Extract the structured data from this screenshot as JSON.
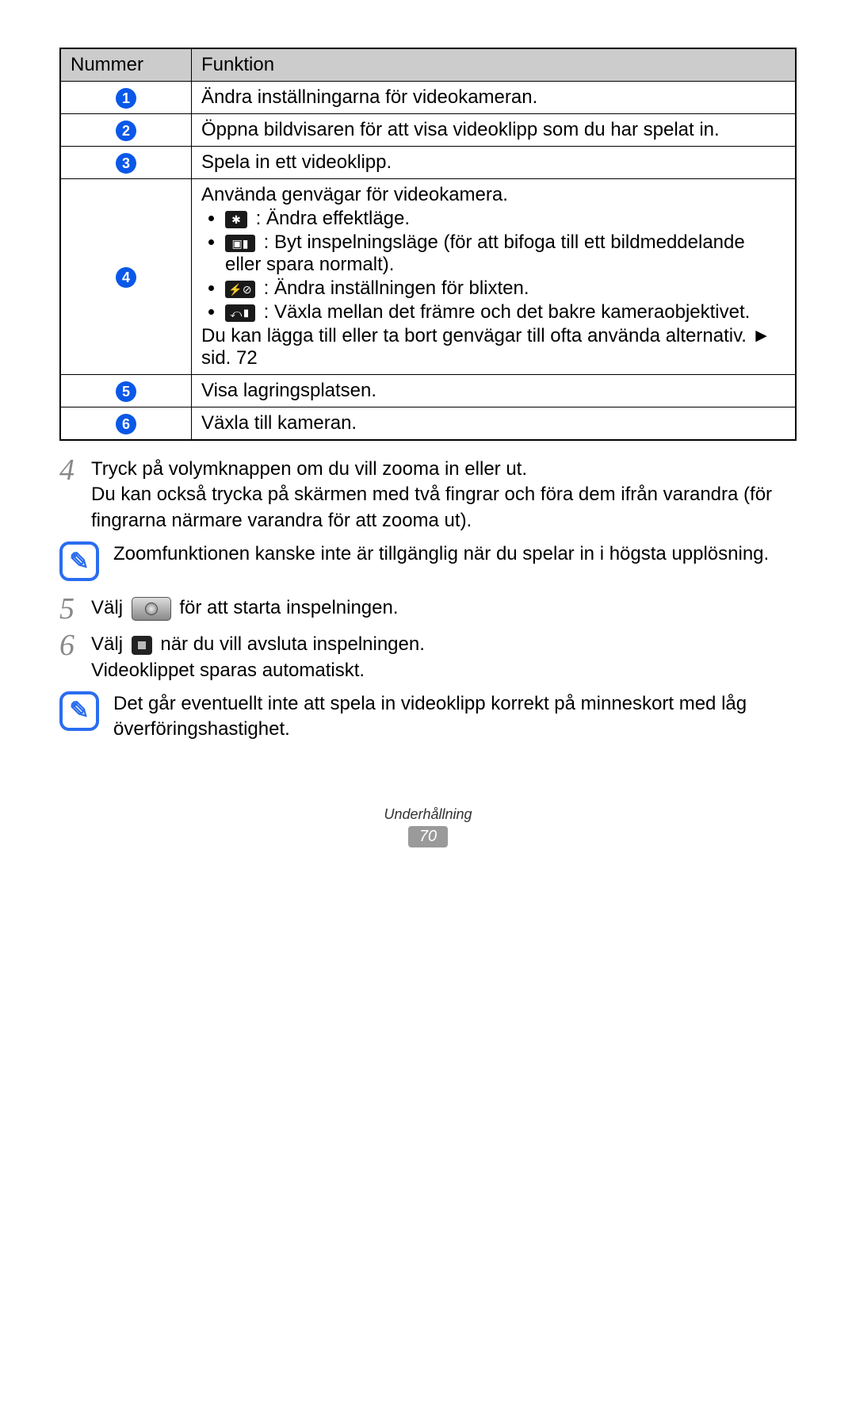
{
  "table": {
    "header_num": "Nummer",
    "header_func": "Funktion",
    "rows": {
      "1": "Ändra inställningarna för videokameran.",
      "2": "Öppna bildvisaren för att visa videoklipp som du har spelat in.",
      "3": "Spela in ett videoklipp.",
      "4": {
        "intro": "Använda genvägar för videokamera.",
        "b1": ": Ändra effektläge.",
        "b2": ": Byt inspelningsläge (för att bifoga till ett bildmeddelande eller spara normalt).",
        "b3": ": Ändra inställningen för blixten.",
        "b4": ": Växla mellan det främre och det bakre kameraobjektivet.",
        "outro": "Du kan lägga till eller ta bort genvägar till ofta använda alternativ. ► sid. 72"
      },
      "5": "Visa lagringsplatsen.",
      "6": "Växla till kameran."
    }
  },
  "steps": {
    "s4a": "Tryck på volymknappen om du vill zooma in eller ut.",
    "s4b": "Du kan också trycka på skärmen med två fingrar och föra dem ifrån varandra (för fingrarna närmare varandra för att zooma ut).",
    "note1": "Zoomfunktionen kanske inte är tillgänglig när du spelar in i högsta upplösning.",
    "s5a": "Välj ",
    "s5b": " för att starta inspelningen.",
    "s6a": "Välj ",
    "s6b": " när du vill avsluta inspelningen.",
    "s6c": "Videoklippet sparas automatiskt.",
    "note2": "Det går eventuellt inte att spela in videoklipp korrekt på minneskort med låg överföringshastighet."
  },
  "footer": {
    "section": "Underhållning",
    "page": "70"
  },
  "nums": {
    "n4": "4",
    "n5": "5",
    "n6": "6"
  }
}
